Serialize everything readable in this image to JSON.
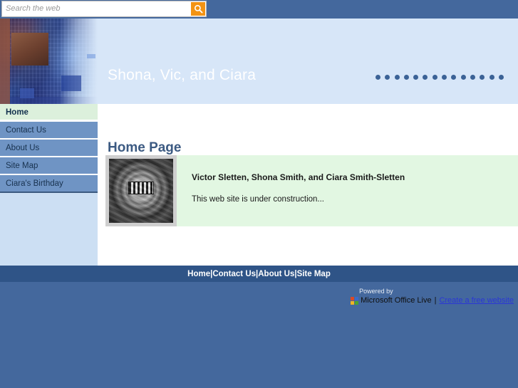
{
  "search": {
    "placeholder": "Search the web",
    "value": "",
    "button_icon": "search-icon"
  },
  "banner": {
    "site_title": "Shona, Vic, and Ciara",
    "photo_alt": "circuit-board-photo",
    "dot_count": 14,
    "dot_color": "#3b6296",
    "background_color": "#d7e6f8"
  },
  "sidebar": {
    "items": [
      {
        "label": "Home",
        "active": true
      },
      {
        "label": "Contact Us",
        "active": false
      },
      {
        "label": "About Us",
        "active": false
      },
      {
        "label": "Site Map",
        "active": false
      },
      {
        "label": "Ciara's Birthday",
        "active": false
      }
    ],
    "active_bg": "#dcf0dc",
    "item_bg": "#6f94c4"
  },
  "main": {
    "page_title": "Home Page",
    "content": {
      "image_alt": "gears-clock-photo",
      "heading": "Victor Sletten, Shona Smith, and Ciara Smith-Sletten",
      "body": "This web site is under construction...",
      "background_color": "#e2f7e2"
    }
  },
  "footer": {
    "nav": [
      {
        "label": "Home"
      },
      {
        "label": "Contact Us"
      },
      {
        "label": "About Us"
      },
      {
        "label": "Site Map"
      }
    ],
    "separator": "|",
    "powered_by_label": "Powered by",
    "powered_by_name": "Microsoft Office Live",
    "powered_by_pipe": "|",
    "powered_by_link": "Create a free website",
    "nav_bg": "#2f5487",
    "bg": "#44689d"
  }
}
